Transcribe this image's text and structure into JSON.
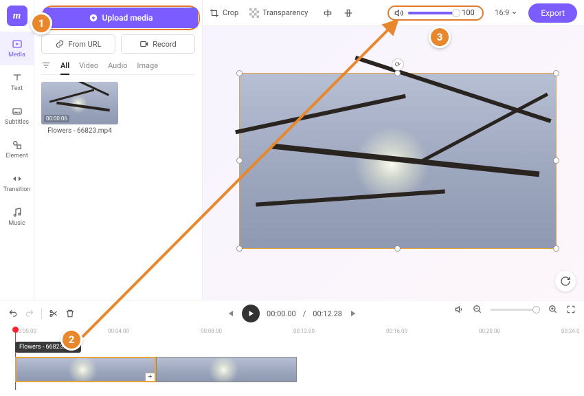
{
  "rail": {
    "items": [
      {
        "label": "Media",
        "active": true
      },
      {
        "label": "Text"
      },
      {
        "label": "Subtitles"
      },
      {
        "label": "Element"
      },
      {
        "label": "Transition"
      },
      {
        "label": "Music"
      }
    ]
  },
  "media": {
    "upload_label": "Upload media",
    "from_url_label": "From URL",
    "record_label": "Record",
    "tabs": [
      "All",
      "Video",
      "Audio",
      "Image"
    ],
    "thumb_duration": "00:00:06",
    "thumb_name": "Flowers - 66823.mp4"
  },
  "toolbar": {
    "crop": "Crop",
    "transparency": "Transparency",
    "volume_value": "100",
    "ratio": "16:9",
    "export": "Export"
  },
  "timeline": {
    "current": "00:00.00",
    "total": "00:12.28",
    "ticks": [
      "00:00.00",
      "00:04.00",
      "00:08.00",
      "00:12.00",
      "00:16.00",
      "00:20.00",
      "00:24.0"
    ],
    "clip_label": "Flowers - 66823.mp4"
  },
  "steps": {
    "s1": "1",
    "s2": "2",
    "s3": "3"
  }
}
